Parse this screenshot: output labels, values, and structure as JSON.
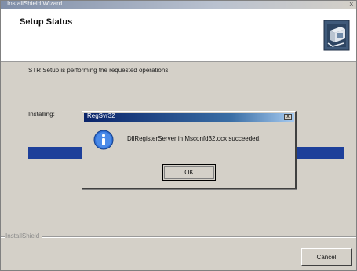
{
  "window": {
    "title": "InstallShield Wizard",
    "close_glyph": "x"
  },
  "header": {
    "heading": "Setup Status",
    "icon": "setup-computer-icon"
  },
  "main": {
    "status_text": "STR Setup is performing the requested operations.",
    "installing_label": "Installing:",
    "progress_fraction": 1.0
  },
  "footer": {
    "brand": "InstallShield",
    "cancel_label": "Cancel"
  },
  "dialog": {
    "title": "RegSvr32",
    "close_glyph": "x",
    "icon": "info-icon",
    "message": "DllRegisterServer in Msconfd32.ocx succeeded.",
    "ok_label": "OK"
  },
  "colors": {
    "progress": "#1d3f9a",
    "dialog_titlebar": "#0a246a"
  }
}
